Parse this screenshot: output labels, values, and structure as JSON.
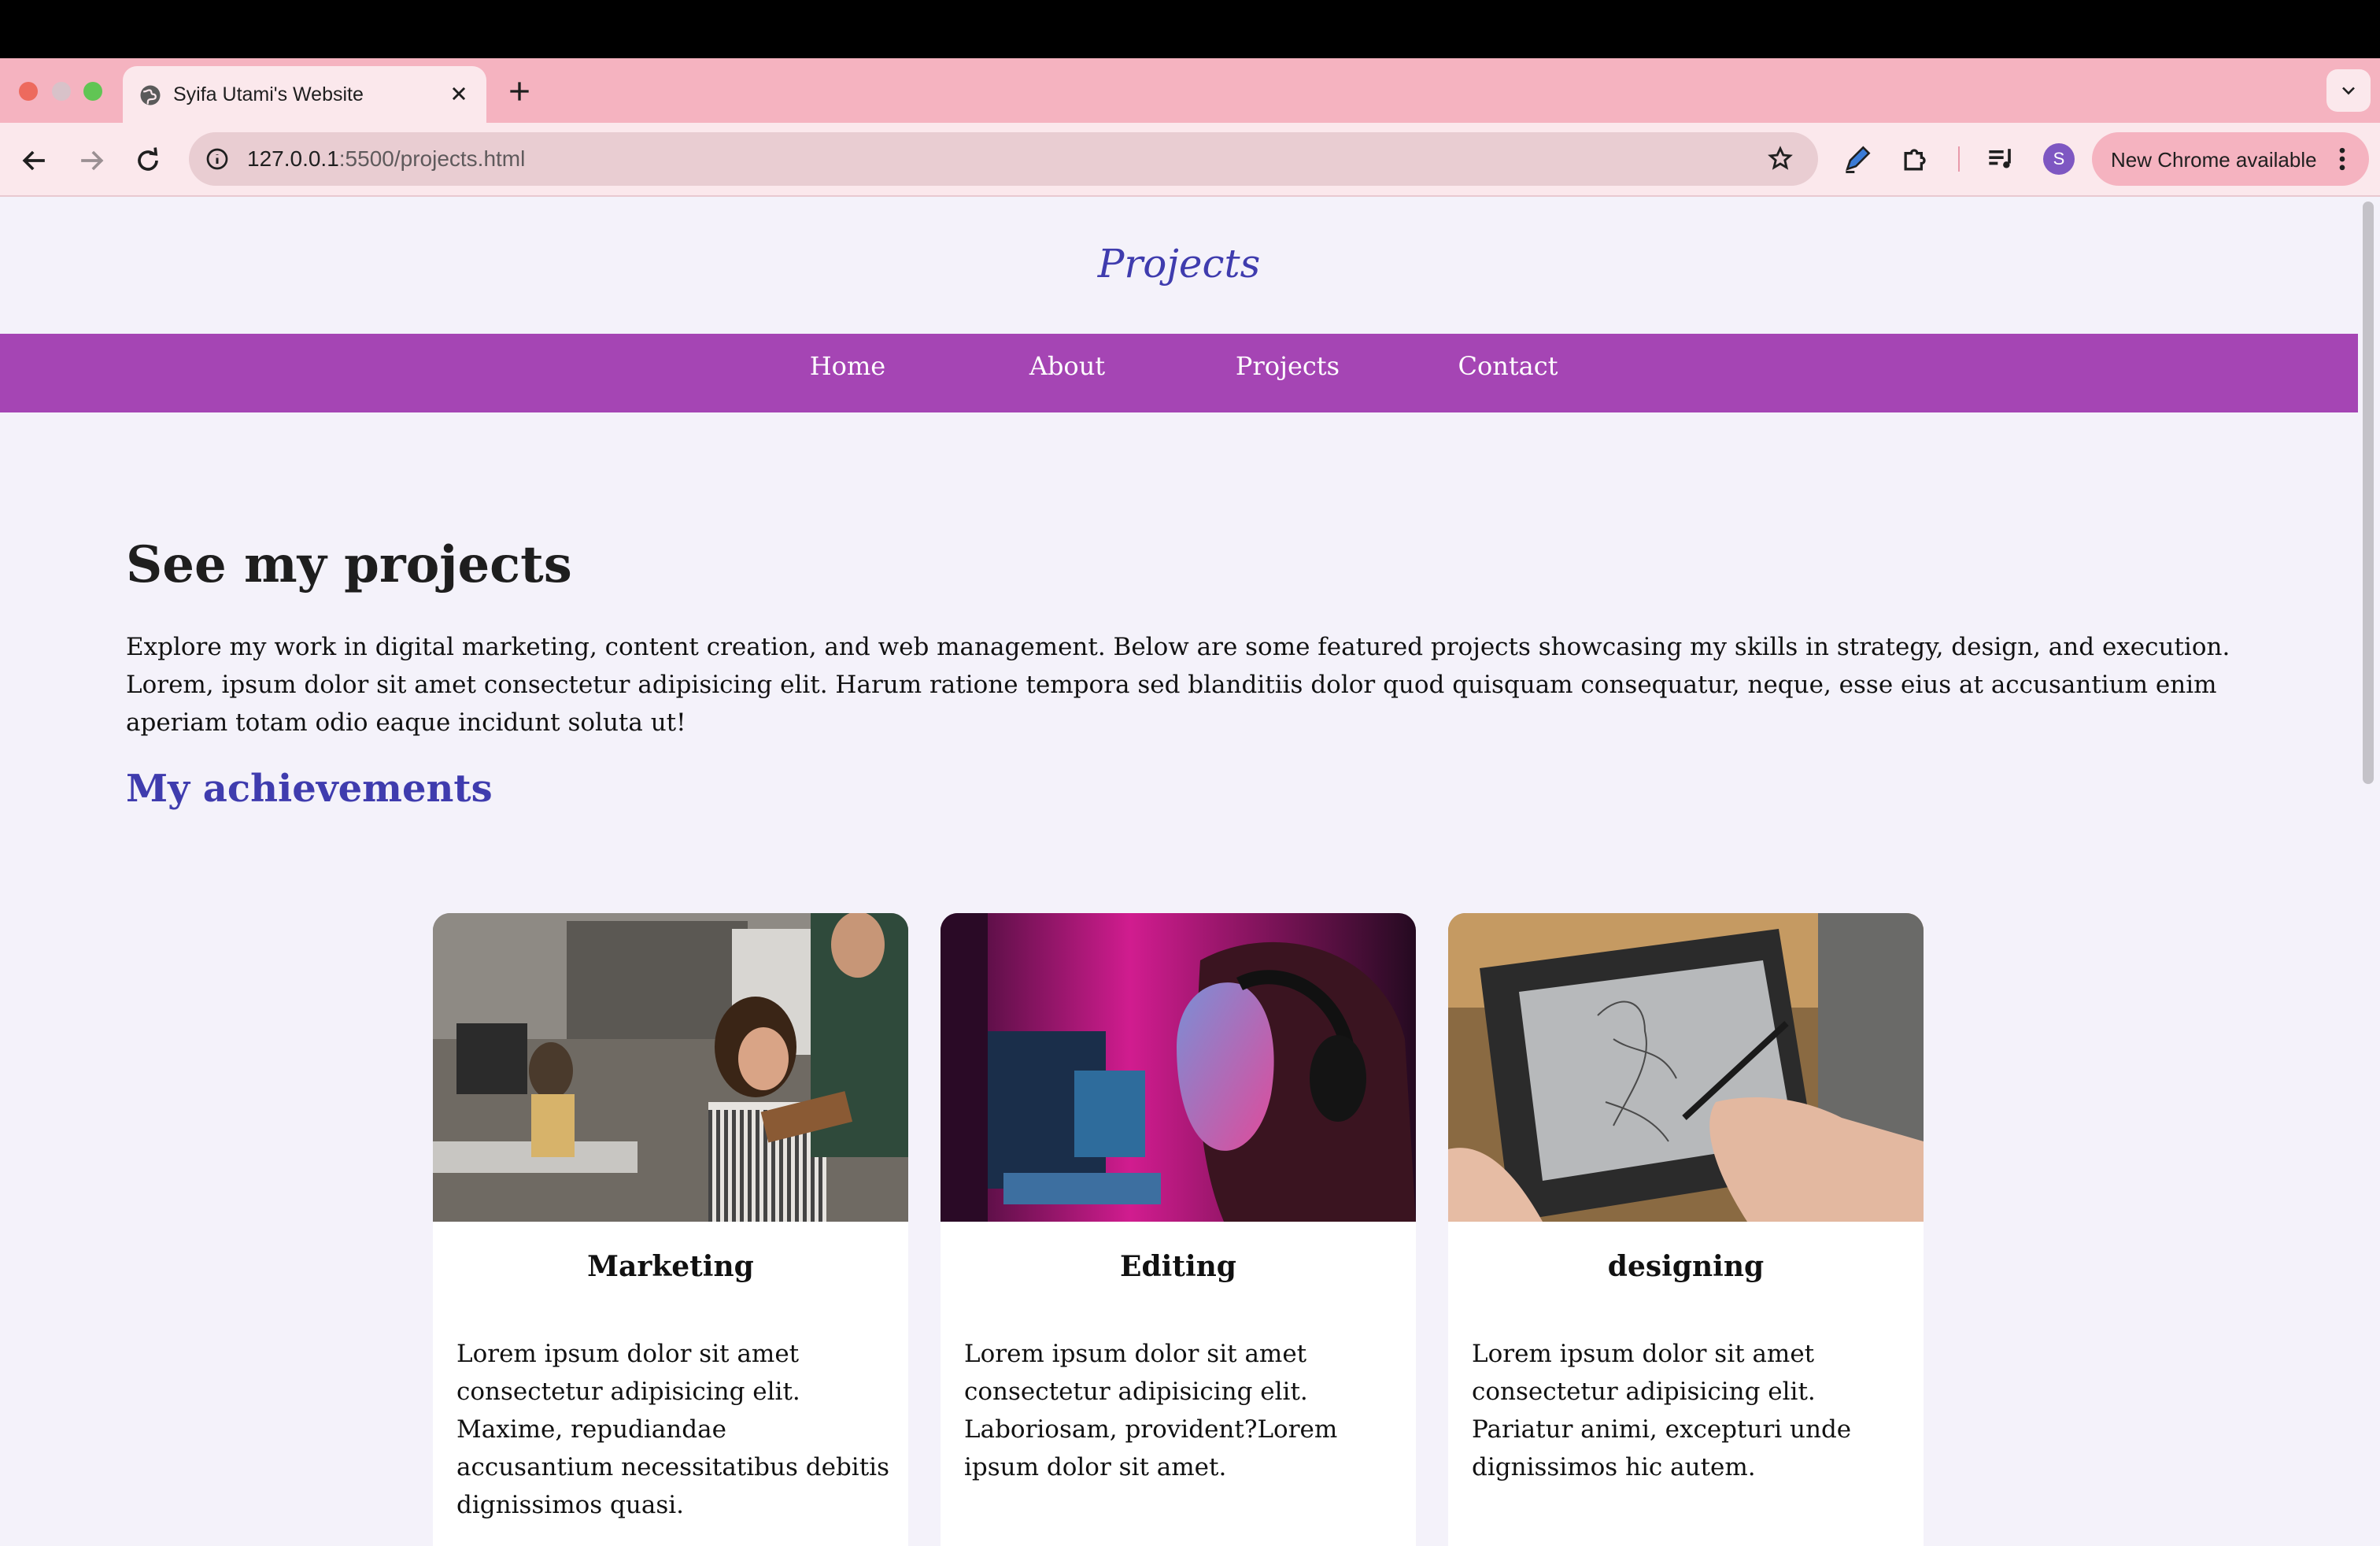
{
  "browser": {
    "tab_title": "Syifa Utami's Website",
    "url_host": "127.0.0.1",
    "url_rest": ":5500/projects.html",
    "avatar_initial": "S",
    "update_label": "New Chrome available"
  },
  "site": {
    "title": "Projects",
    "nav": [
      "Home",
      "About",
      "Projects",
      "Contact"
    ]
  },
  "main": {
    "heading": "See my projects",
    "intro": "Explore my work in digital marketing, content creation, and web management. Below are some featured projects showcasing my skills in strategy, design, and execution. Lorem, ipsum dolor sit amet consectetur adipisicing elit. Harum ratione tempora sed blanditiis dolor quod quisquam consequatur, neque, esse eius at accusantium enim aperiam totam odio eaque incidunt soluta ut!",
    "subheading": "My achievements",
    "cards": [
      {
        "title": "Marketing",
        "text": "Lorem ipsum dolor sit amet consectetur adipisicing elit. Maxime, repudiandae accusantium necessitatibus debitis dignissimos quasi."
      },
      {
        "title": "Editing",
        "text": "Lorem ipsum dolor sit amet consectetur adipisicing elit. Laboriosam, provident?Lorem ipsum dolor sit amet."
      },
      {
        "title": "designing",
        "text": "Lorem ipsum dolor sit amet consectetur adipisicing elit. Pariatur animi, excepturi unde dignissimos hic autem."
      }
    ]
  },
  "colors": {
    "tabstrip": "#f5b3c0",
    "nav_bar": "#a545b4",
    "accent_title": "#3f3cae"
  }
}
